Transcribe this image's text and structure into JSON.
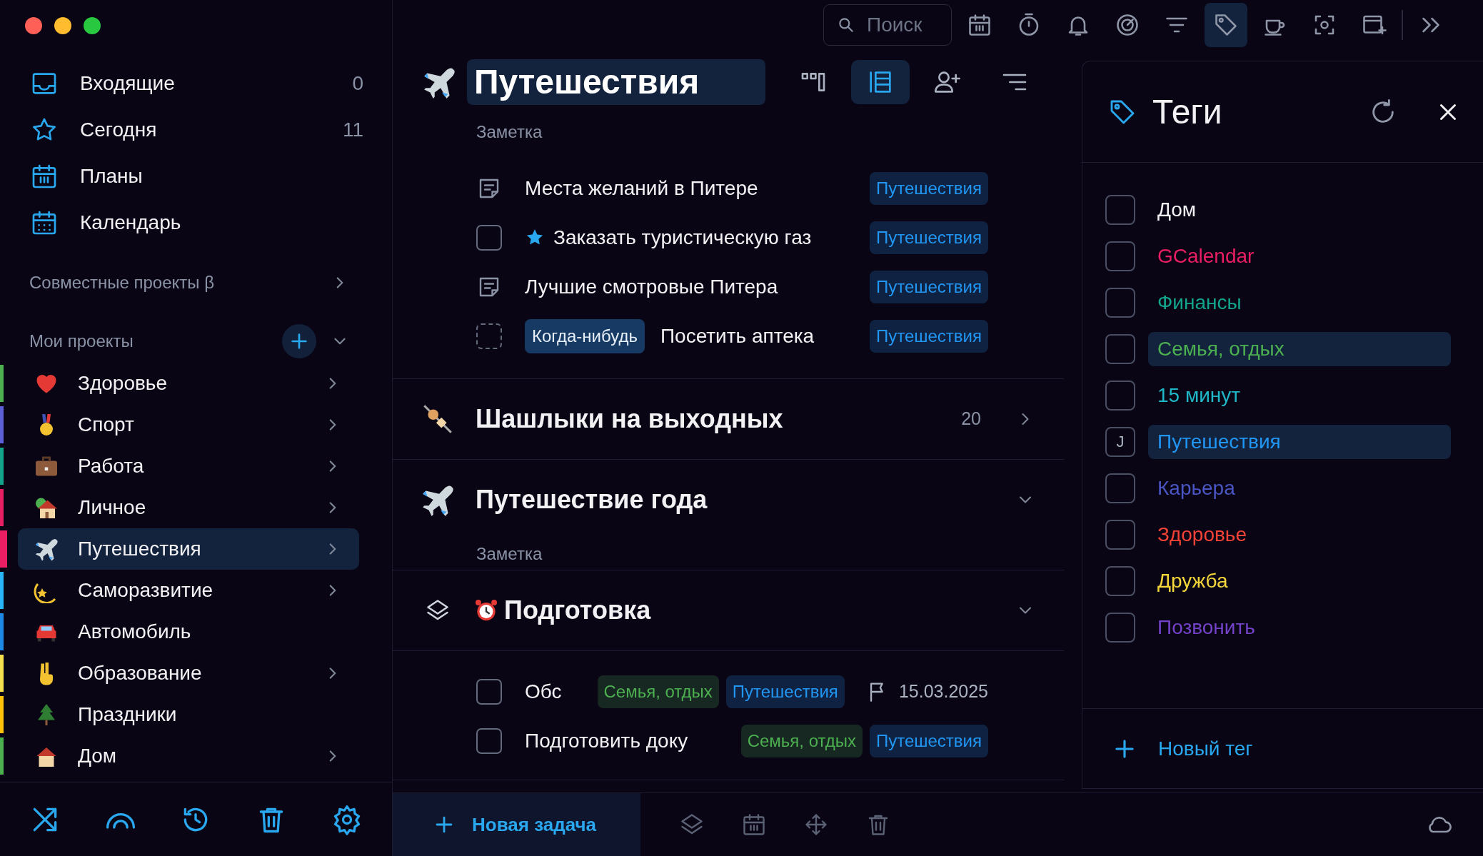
{
  "sidebar": {
    "nav": [
      {
        "label": "Входящие",
        "count": "0"
      },
      {
        "label": "Сегодня",
        "count": "11"
      },
      {
        "label": "Планы"
      },
      {
        "label": "Календарь"
      }
    ],
    "shared_section": "Совместные проекты β",
    "projects_section": "Мои проекты",
    "projects": [
      {
        "label": "Здоровье",
        "color": "#4caf50",
        "has_children": true,
        "selected": false
      },
      {
        "label": "Спорт",
        "color": "#5c5fd6",
        "has_children": true,
        "selected": false
      },
      {
        "label": "Работа",
        "color": "#13a58c",
        "has_children": true,
        "selected": false
      },
      {
        "label": "Личное",
        "color": "#e91e63",
        "has_children": true,
        "selected": false
      },
      {
        "label": "Путешествия",
        "color": "#e91e63",
        "has_children": true,
        "selected": true
      },
      {
        "label": "Саморазвитие",
        "color": "#29b6f6",
        "has_children": true,
        "selected": false
      },
      {
        "label": "Автомобиль",
        "color": "#1e88e5",
        "has_children": false,
        "selected": false
      },
      {
        "label": "Образование",
        "color": "#f5e050",
        "has_children": true,
        "selected": false
      },
      {
        "label": "Праздники",
        "color": "#ffc107",
        "has_children": false,
        "selected": false
      },
      {
        "label": "Дом",
        "color": "#4caf50",
        "has_children": true,
        "selected": false
      }
    ]
  },
  "toolbar": {
    "search": {
      "placeholder": "Поиск"
    },
    "tools": [
      {
        "selected": false
      },
      {
        "selected": false
      },
      {
        "selected": false
      },
      {
        "selected": false
      },
      {
        "selected": false
      },
      {
        "selected": true
      },
      {
        "selected": false
      },
      {
        "selected": false
      },
      {
        "selected": false
      },
      {
        "selected": false
      }
    ]
  },
  "project": {
    "title": "Путешествия",
    "note": "Заметка",
    "views": [
      {
        "selected": false
      },
      {
        "selected": true
      },
      {
        "selected": false
      },
      {
        "selected": false
      }
    ],
    "tasks": [
      {
        "kind": "note",
        "title": "Места желаний в Питере",
        "starred": false,
        "tags": [
          {
            "label": "Путешествия",
            "color": "#2196f3"
          }
        ]
      },
      {
        "kind": "task",
        "title": "Заказать туристическую газ",
        "checked": false,
        "starred": true,
        "tags": [
          {
            "label": "Путешествия",
            "color": "#2196f3"
          }
        ]
      },
      {
        "kind": "note",
        "title": "Лучшие смотровые Питера",
        "starred": false,
        "tags": [
          {
            "label": "Путешествия",
            "color": "#2196f3"
          }
        ]
      },
      {
        "kind": "someday",
        "badge": "Когда-нибудь",
        "title": "Посетить аптека",
        "checked": false,
        "starred": false,
        "tags": [
          {
            "label": "Путешествия",
            "color": "#2196f3"
          }
        ]
      }
    ]
  },
  "groups": [
    {
      "kind": "project",
      "title": "Шашлыки на выходных",
      "count": "20",
      "expanded": false
    },
    {
      "kind": "project",
      "title": "Путешествие года",
      "note": "Заметка",
      "expanded": true
    },
    {
      "kind": "heading",
      "title": "Подготовка",
      "expanded": true,
      "tasks": [
        {
          "kind": "task",
          "title": "Обс",
          "checked": false,
          "starred": false,
          "tags": [
            {
              "label": "Семья, отдых",
              "color": "#4caf50"
            },
            {
              "label": "Путешествия",
              "color": "#2196f3"
            }
          ],
          "date": "15.03.2025"
        },
        {
          "kind": "task",
          "title": "Подготовить доку",
          "checked": false,
          "starred": false,
          "tags": [
            {
              "label": "Семья, отдых",
              "color": "#4caf50"
            },
            {
              "label": "Путешествия",
              "color": "#2196f3"
            }
          ]
        }
      ]
    }
  ],
  "new_task": "Новая задача",
  "tags_panel": {
    "title": "Теги",
    "tags": [
      {
        "label": "Дом",
        "color": "#f2f2f5",
        "checked": false,
        "selected": false
      },
      {
        "label": "GCalendar",
        "color": "#e91e63",
        "checked": false,
        "selected": false
      },
      {
        "label": "Финансы",
        "color": "#13a58c",
        "checked": false,
        "selected": false
      },
      {
        "label": "Семья, отдых",
        "color": "#4caf50",
        "checked": false,
        "selected": true
      },
      {
        "label": "15 минут",
        "color": "#1eb8c8",
        "checked": false,
        "selected": false
      },
      {
        "label": "Путешествия",
        "color": "#2196f3",
        "checked": false,
        "selected": true,
        "shortcut": "J"
      },
      {
        "label": "Карьера",
        "color": "#4a55c4",
        "checked": false,
        "selected": false
      },
      {
        "label": "Здоровье",
        "color": "#f44336",
        "checked": false,
        "selected": false
      },
      {
        "label": "Дружба",
        "color": "#f5d63a",
        "checked": false,
        "selected": false
      },
      {
        "label": "Позвонить",
        "color": "#7342c9",
        "checked": false,
        "selected": false
      }
    ],
    "new_tag": "Новый тег"
  }
}
